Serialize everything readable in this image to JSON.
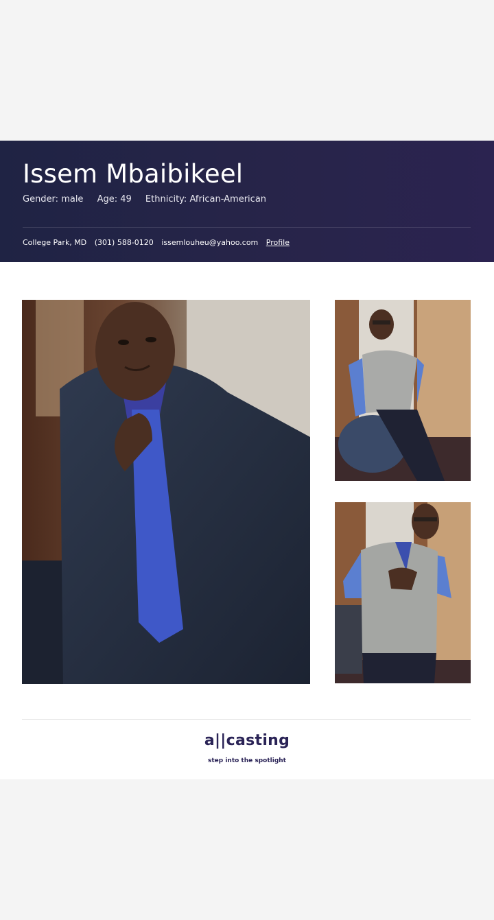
{
  "profile": {
    "name": "Issem Mbaibikeel",
    "gender": "Gender: male",
    "age": "Age: 49",
    "ethnicity": "Ethnicity: African-American",
    "location": "College Park, MD",
    "phone": "(301) 588-0120",
    "email": "issemlouheu@yahoo.com",
    "profile_link": "Profile"
  },
  "photos": {
    "main": "headshot-suit-blue-tie",
    "side_1": "seated-gray-vest",
    "side_2": "standing-gray-vest"
  },
  "footer": {
    "logo": "a||casting",
    "tagline": "step into the spotlight"
  },
  "colors": {
    "header_bg": "#272449",
    "brand": "#2a2356"
  }
}
